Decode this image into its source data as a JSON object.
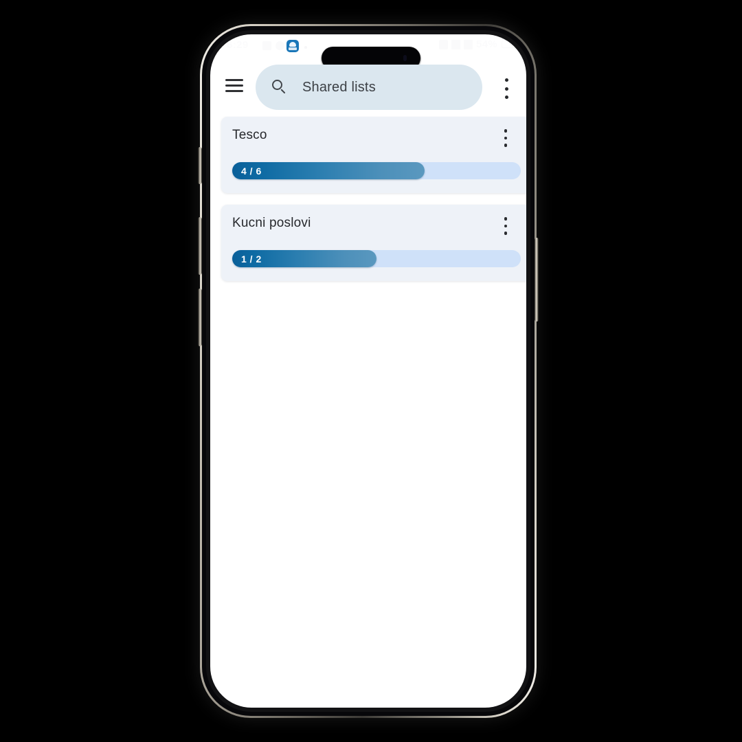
{
  "device": {
    "type": "smartphone",
    "status_bar": {
      "time": "6:29",
      "battery_percent": "54%",
      "app_icon_name": "blue-app-icon",
      "left_icon_names": [
        "notification-icon",
        "notification-icon-round",
        "blue-app-icon",
        "overflow-dot"
      ],
      "right_icon_names": [
        "alarm-icon",
        "wifi-icon",
        "signal-icon",
        "battery-icon"
      ]
    }
  },
  "appbar": {
    "menu_icon": "hamburger-menu-icon",
    "search": {
      "icon": "search-icon",
      "value": "Shared lists"
    },
    "overflow_icon": "more-vertical-icon"
  },
  "colors": {
    "screen_background": "#ffffff",
    "search_bar_background": "#dbe7ef",
    "card_background": "#eef2f8",
    "progress_track": "#cfe1f9",
    "progress_fill_start": "#0a5f99",
    "progress_fill_end": "#5a98bf",
    "title_text": "#26282c"
  },
  "lists": [
    {
      "name": "Tesco",
      "progress_label": "4 / 6",
      "completed": 4,
      "total": 6,
      "percent": 66.7,
      "overflow_icon": "more-vertical-icon"
    },
    {
      "name": "Kucni poslovi",
      "progress_label": "1 / 2",
      "completed": 1,
      "total": 2,
      "percent": 50,
      "overflow_icon": "more-vertical-icon"
    }
  ]
}
